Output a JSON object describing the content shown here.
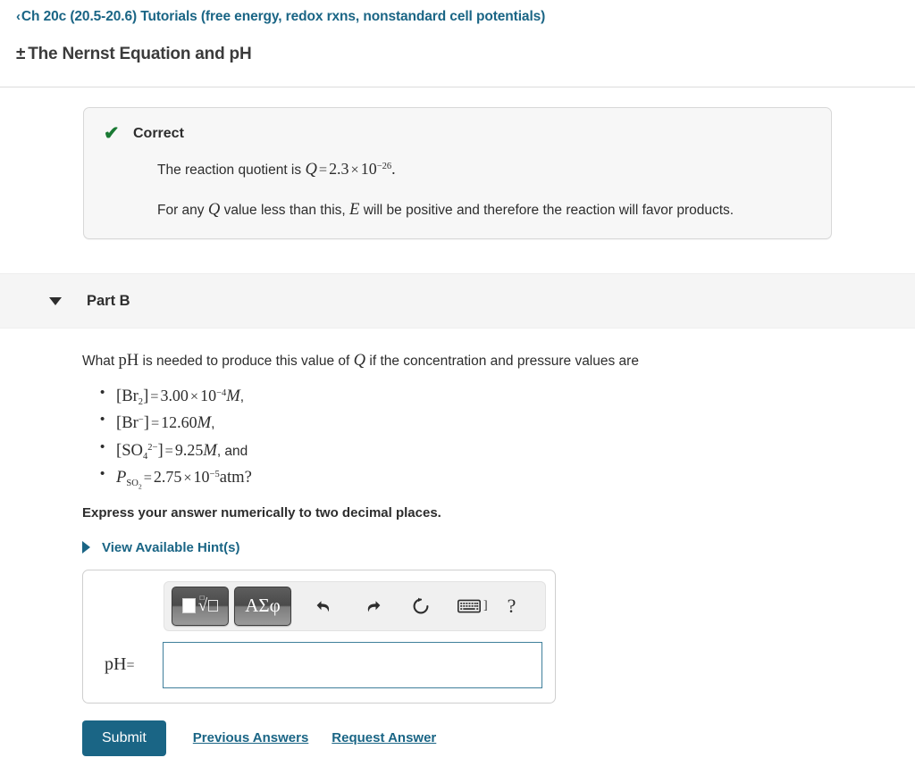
{
  "header": {
    "breadcrumb_chevron": "‹",
    "breadcrumb_label": "Ch 20c (20.5-20.6) Tutorials (free energy, redox rxns, nonstandard cell potentials)",
    "plus_minus": "±",
    "assignment_title": "The Nernst Equation and pH",
    "link_color": "#1a6585"
  },
  "feedback": {
    "icon": "check-icon",
    "icon_glyph": "✔",
    "icon_color": "#1a7a34",
    "status": "Correct",
    "line1": {
      "prefix": "The reaction quotient is ",
      "var": "Q",
      "equals": "=",
      "mantissa": "2.3",
      "times": "×",
      "base": "10",
      "exponent": "−26",
      "suffix": "."
    },
    "line2": {
      "part1": "For any ",
      "var1": "Q",
      "part2": " value less than this, ",
      "var2": "E",
      "part3": " will be positive and therefore the reaction will favor products."
    },
    "background": "#f7f7f7",
    "border": "#d8d8d8"
  },
  "part": {
    "caret": "chevron-down-icon",
    "label": "Part B",
    "header_background": "#f5f5f5"
  },
  "question": {
    "text_before": "What ",
    "ph": "pH",
    "text_mid": " is needed to produce this value of ",
    "q": "Q",
    "text_after": " if the concentration and pressure values are",
    "values": [
      {
        "species": "Br",
        "species_sub": "2",
        "species_sup": "",
        "bracketed": true,
        "symbol": "",
        "equals": "=",
        "mantissa": "3.00",
        "times": "×",
        "base": "10",
        "exponent": "−4",
        "unit": "M",
        "trailing": ","
      },
      {
        "species": "Br",
        "species_sub": "",
        "species_sup": "−",
        "bracketed": true,
        "symbol": "",
        "equals": "=",
        "mantissa": "12.60",
        "times": "",
        "base": "",
        "exponent": "",
        "unit": "M",
        "trailing": ","
      },
      {
        "species": "SO",
        "species_sub": "4",
        "species_sup": "2−",
        "bracketed": true,
        "symbol": "",
        "equals": "=",
        "mantissa": "9.25",
        "times": "",
        "base": "",
        "exponent": "",
        "unit": "M",
        "trailing": ", and"
      },
      {
        "species": "SO",
        "species_sub": "2",
        "species_sup": "",
        "bracketed": false,
        "symbol": "P",
        "equals": "=",
        "mantissa": "2.75",
        "times": "×",
        "base": "10",
        "exponent": "−5",
        "unit": "atm",
        "trailing": "?"
      }
    ],
    "instruction": "Express your answer numerically to two decimal places."
  },
  "hints": {
    "caret": "chevron-right-icon",
    "label": "View Available Hint(s)"
  },
  "answer": {
    "toolbar": {
      "templates_button": "math-templates-button",
      "greek_button_label": "ΑΣφ",
      "undo": "undo-icon",
      "redo": "redo-icon",
      "reset": "reset-icon",
      "keyboard": "keyboard-icon",
      "keyboard_bracket": "]",
      "help": "?"
    },
    "field_label": "pH",
    "field_equals": "=",
    "field_value": "",
    "field_placeholder": "",
    "field_border_color": "#3f7f9b"
  },
  "actions": {
    "submit_label": "Submit",
    "previous_answers_label": "Previous Answers",
    "request_answer_label": "Request Answer",
    "submit_color": "#1a6585"
  }
}
